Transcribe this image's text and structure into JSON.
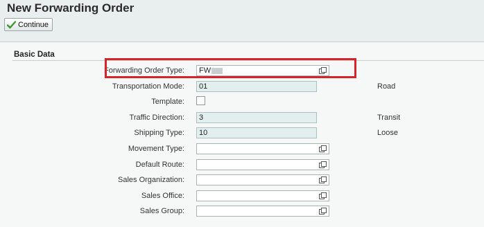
{
  "header": {
    "title": "New Forwarding Order",
    "continue_label": "Continue"
  },
  "section": {
    "title": "Basic Data"
  },
  "fields": [
    {
      "label": "Forwarding Order Type:",
      "value": "FW",
      "description": ""
    },
    {
      "label": "Transportation Mode:",
      "value": "01",
      "description": "Road"
    },
    {
      "label": "Template:",
      "value": "",
      "description": ""
    },
    {
      "label": "Traffic Direction:",
      "value": "3",
      "description": "Transit"
    },
    {
      "label": "Shipping Type:",
      "value": "10",
      "description": "Loose"
    },
    {
      "label": "Movement Type:",
      "value": "",
      "description": ""
    },
    {
      "label": "Default Route:",
      "value": "",
      "description": ""
    },
    {
      "label": "Sales Organization:",
      "value": "",
      "description": ""
    },
    {
      "label": "Sales Office:",
      "value": "",
      "description": ""
    },
    {
      "label": "Sales Group:",
      "value": "",
      "description": ""
    }
  ],
  "colors": {
    "highlight": "#d6252a",
    "readonly_bg": "#e3efef",
    "check_icon": "#3a9a2e"
  }
}
